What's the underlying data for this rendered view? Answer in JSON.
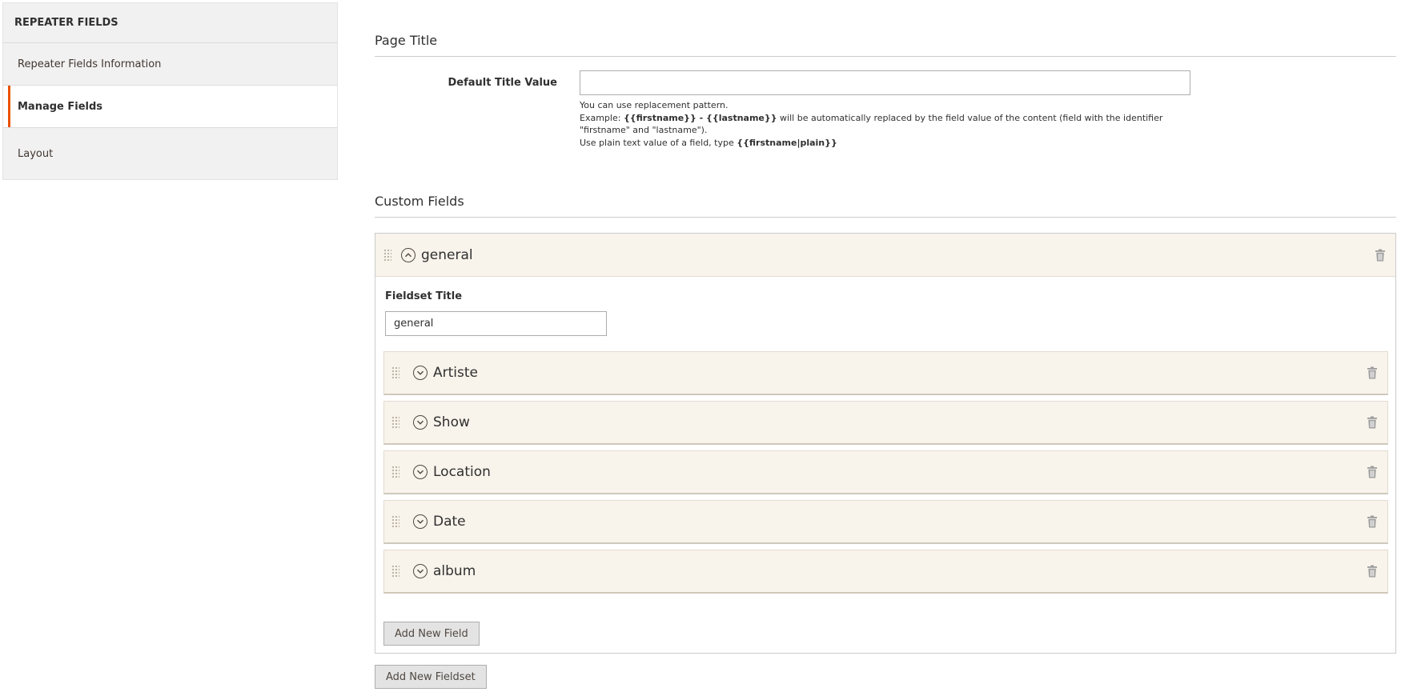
{
  "sidebar": {
    "title": "REPEATER FIELDS",
    "items": [
      {
        "label": "Repeater Fields Information"
      },
      {
        "label": "Manage Fields"
      },
      {
        "label": "Layout"
      }
    ]
  },
  "page_title": {
    "heading": "Page Title",
    "default_label": "Default Title Value",
    "default_value": "",
    "note_line1": "You can use replacement pattern.",
    "note_example_prefix": "Example: ",
    "note_example_code": "{{firstname}} - {{lastname}}",
    "note_example_suffix": " will be automatically replaced by the field value of the content (field with the identifier \"firstname\" and \"lastname\").",
    "note_plain_prefix": "Use plain text value of a field, type ",
    "note_plain_code": "{{firstname|plain}}"
  },
  "custom_fields": {
    "heading": "Custom Fields",
    "fieldset": {
      "title": "general",
      "title_label": "Fieldset Title",
      "title_value": "general",
      "fields": [
        {
          "label": "Artiste"
        },
        {
          "label": "Show"
        },
        {
          "label": "Location"
        },
        {
          "label": "Date"
        },
        {
          "label": "album"
        }
      ],
      "add_field_label": "Add New Field"
    },
    "add_fieldset_label": "Add New Fieldset"
  },
  "colors": {
    "accent": "#eb5202",
    "header_bg": "#f8f3eb"
  }
}
